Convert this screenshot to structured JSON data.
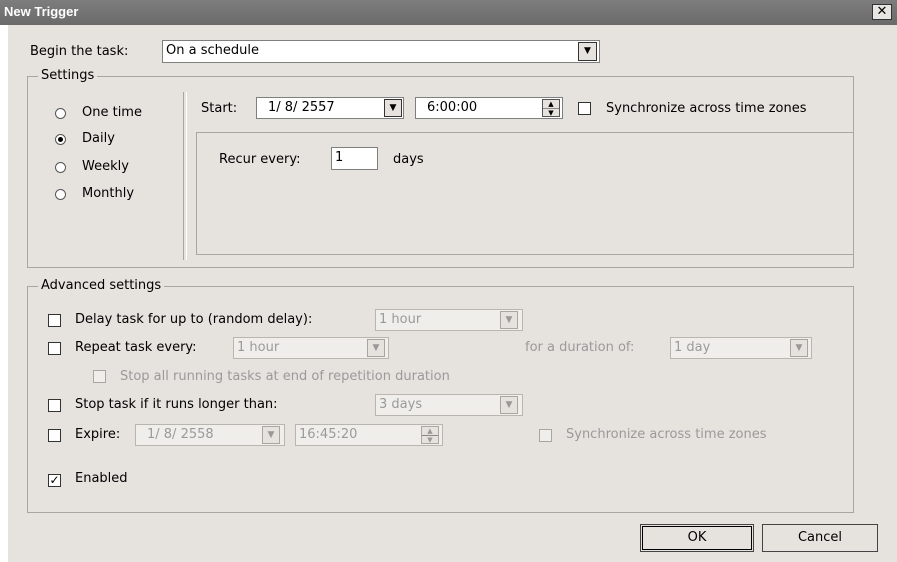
{
  "window": {
    "title": "New Trigger",
    "close_glyph": "✕"
  },
  "begin": {
    "label": "Begin the task:",
    "value": "On a schedule"
  },
  "settings": {
    "legend": "Settings",
    "radios": [
      {
        "label": "One time",
        "checked": false
      },
      {
        "label": "Daily",
        "checked": true
      },
      {
        "label": "Weekly",
        "checked": false
      },
      {
        "label": "Monthly",
        "checked": false
      }
    ],
    "start_label": "Start:",
    "start_date": "1/ 8/ 2557",
    "start_time": "6:00:00",
    "sync_label": "Synchronize across time zones",
    "sync_checked": false,
    "recur_label": "Recur every:",
    "recur_value": "1",
    "recur_unit": "days"
  },
  "advanced": {
    "legend": "Advanced settings",
    "delay_label": "Delay task for up to (random delay):",
    "delay_value": "1 hour",
    "repeat_label": "Repeat task every:",
    "repeat_value": "1 hour",
    "duration_label": "for a duration of:",
    "duration_value": "1 day",
    "stop_all_label": "Stop all running tasks at end of repetition duration",
    "stop_longer_label": "Stop task if it runs longer than:",
    "stop_longer_value": "3 days",
    "expire_label": "Expire:",
    "expire_date": "1/ 8/ 2558",
    "expire_time": "16:45:20",
    "expire_sync_label": "Synchronize across time zones",
    "enabled_label": "Enabled",
    "enabled_checked": true
  },
  "buttons": {
    "ok": "OK",
    "cancel": "Cancel"
  },
  "icons": {
    "dropdown": "▼",
    "spin_up": "▲",
    "spin_down": "▼",
    "check": "✓"
  }
}
